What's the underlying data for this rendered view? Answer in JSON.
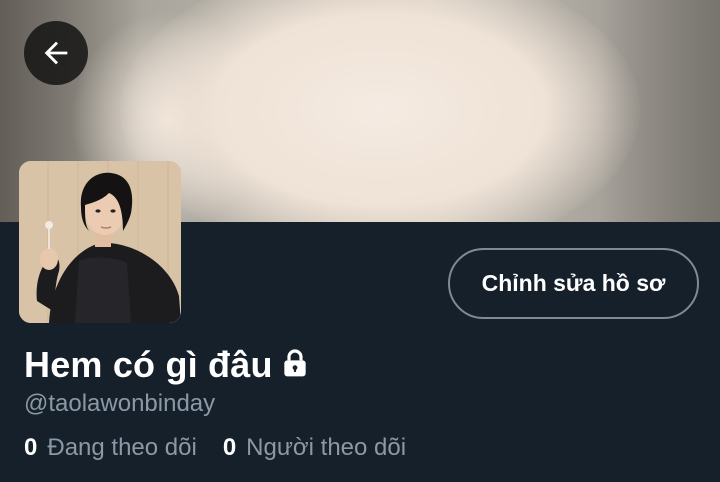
{
  "profile": {
    "display_name": "Hem có gì đâu",
    "handle": "@taolawonbinday",
    "edit_button_label": "Chỉnh sửa hồ sơ",
    "protected": true
  },
  "stats": {
    "following_count": "0",
    "following_label": "Đang theo dõi",
    "followers_count": "0",
    "followers_label": "Người theo dõi"
  },
  "icons": {
    "back": "arrow-left-icon",
    "lock": "lock-icon"
  },
  "colors": {
    "background": "#15202b",
    "text_primary": "#ffffff",
    "text_secondary": "#8b98a5",
    "button_border": "#7d8a97"
  }
}
